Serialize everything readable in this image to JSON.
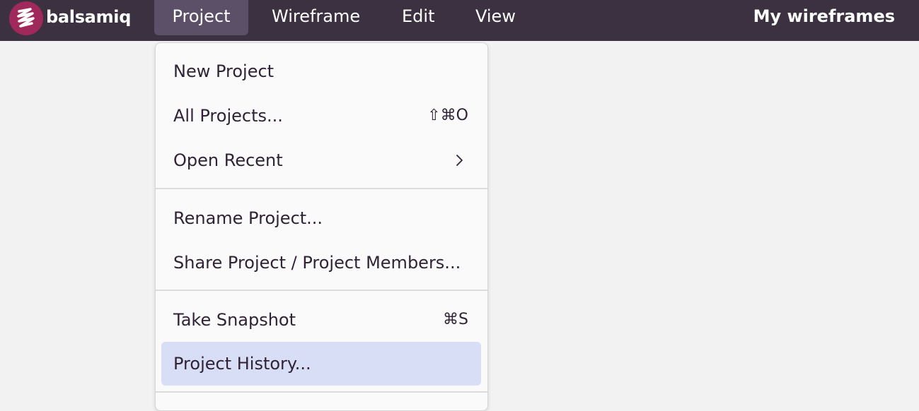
{
  "app": {
    "logo_text": "balsamiq",
    "logo_icon": "balsamiq-scribble-icon",
    "brand_color": "#a0295c",
    "topbar_color": "#3b3140"
  },
  "menubar": {
    "items": [
      {
        "label": "Project",
        "active": true
      },
      {
        "label": "Wireframe",
        "active": false
      },
      {
        "label": "Edit",
        "active": false
      },
      {
        "label": "View",
        "active": false
      }
    ],
    "right_link": "My wireframes"
  },
  "dropdown": {
    "groups": [
      [
        {
          "label": "New Project",
          "shortcut": ""
        },
        {
          "label": "All Projects...",
          "shortcut": "⇧⌘O"
        },
        {
          "label": "Open Recent",
          "shortcut": "",
          "submenu": true,
          "icon": "chevron-right-icon"
        }
      ],
      [
        {
          "label": "Rename Project...",
          "shortcut": ""
        },
        {
          "label": "Share Project / Project Members...",
          "shortcut": ""
        }
      ],
      [
        {
          "label": "Take Snapshot",
          "shortcut": "⌘S"
        },
        {
          "label": "Project History...",
          "shortcut": "",
          "highlighted": true
        }
      ]
    ],
    "highlight_color": "#d8def6"
  }
}
